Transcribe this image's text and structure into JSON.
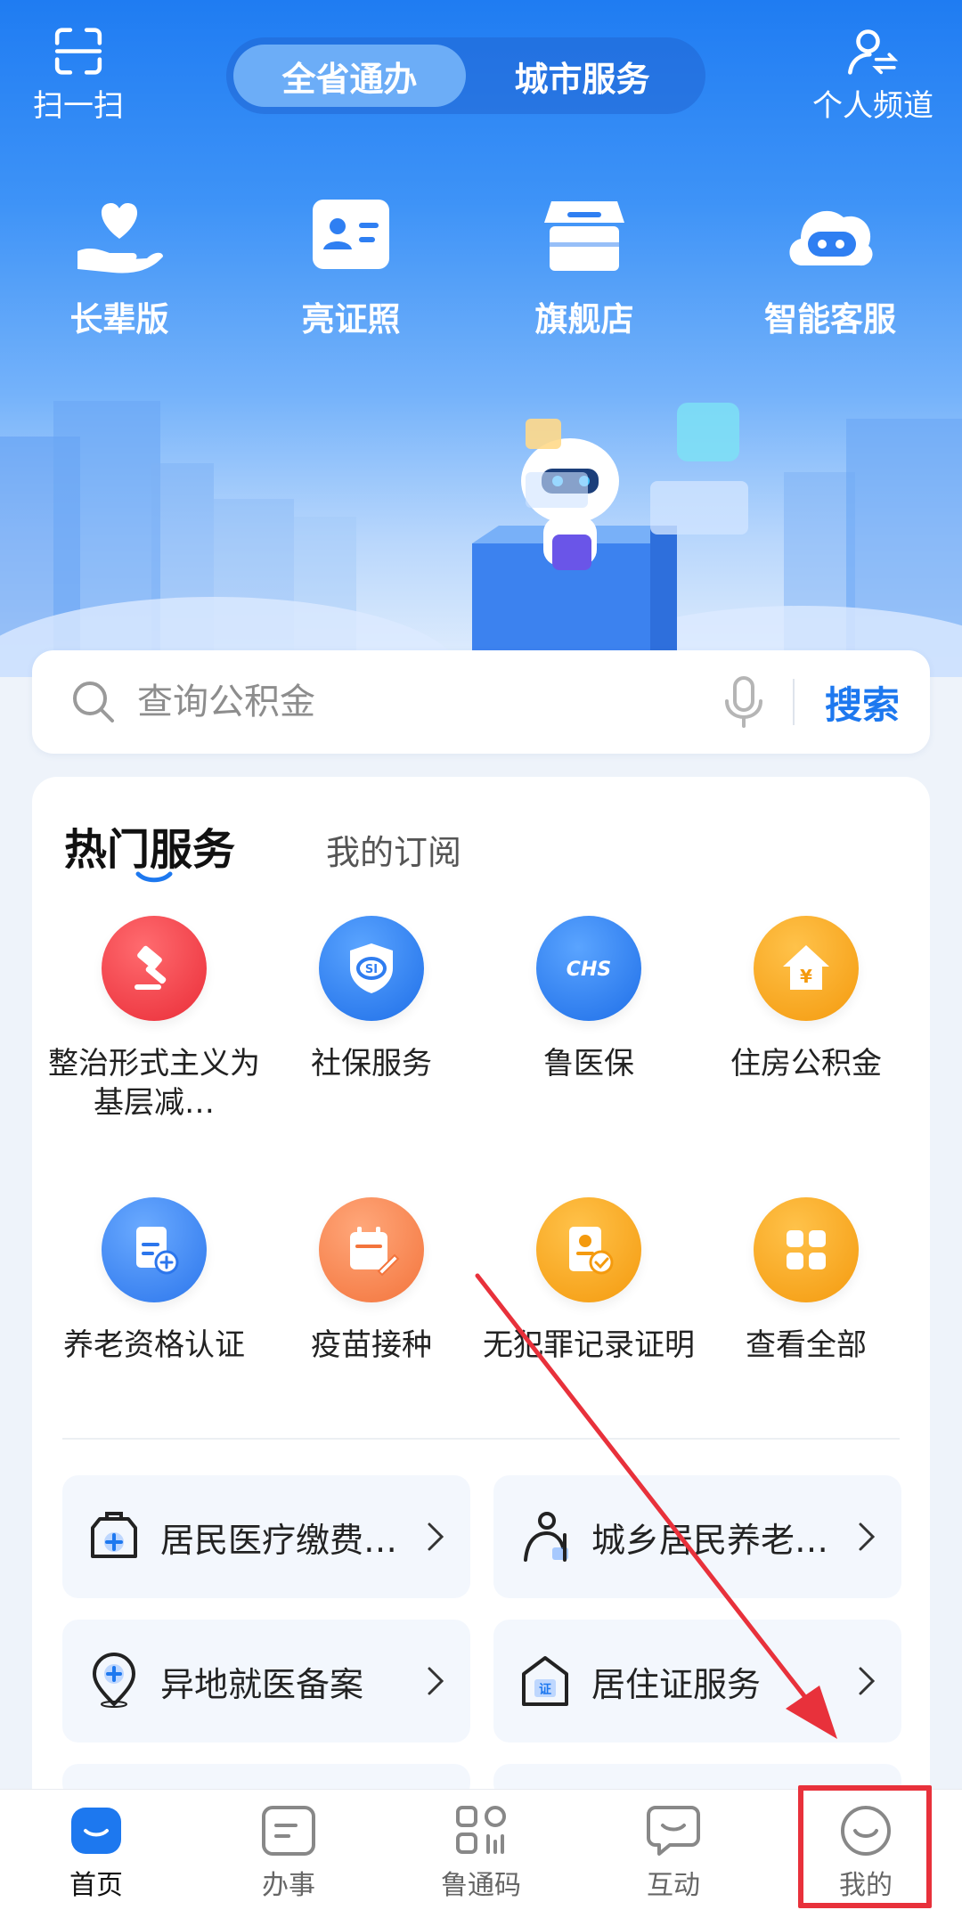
{
  "header": {
    "scan_label": "扫一扫",
    "personal_label": "个人频道",
    "segments": [
      {
        "label": "全省通办",
        "active": true
      },
      {
        "label": "城市服务",
        "active": false
      }
    ]
  },
  "quick_actions": [
    {
      "label": "长辈版",
      "icon": "heart-hand-icon"
    },
    {
      "label": "亮证照",
      "icon": "id-card-icon"
    },
    {
      "label": "旗舰店",
      "icon": "store-icon"
    },
    {
      "label": "智能客服",
      "icon": "robot-cloud-icon"
    }
  ],
  "search": {
    "placeholder": "查询公积金",
    "button_label": "搜索"
  },
  "services": {
    "tab_hot": "热门服务",
    "tab_subscribed": "我的订阅",
    "items": [
      {
        "label": "整治形式主义为基层减…",
        "icon": "gavel-icon",
        "color": "#f2414a"
      },
      {
        "label": "社保服务",
        "icon": "social-security-shield-icon",
        "color": "#2f7df0"
      },
      {
        "label": "鲁医保",
        "icon": "chs-icon",
        "color": "#2f7df0"
      },
      {
        "label": "住房公积金",
        "icon": "house-yuan-icon",
        "color": "#f7a21b"
      },
      {
        "label": "养老资格认证",
        "icon": "document-plus-icon",
        "color": "#3a86f2"
      },
      {
        "label": "疫苗接种",
        "icon": "calendar-vaccine-icon",
        "color": "#f88a52"
      },
      {
        "label": "无犯罪记录证明",
        "icon": "certificate-check-icon",
        "color": "#f7a21b"
      },
      {
        "label": "查看全部",
        "icon": "grid-icon",
        "color": "#f7a21b"
      }
    ]
  },
  "quick_links": [
    {
      "label": "居民医疗缴费…",
      "icon": "medical-bag-icon"
    },
    {
      "label": "城乡居民养老…",
      "icon": "elderly-person-icon"
    },
    {
      "label": "异地就医备案",
      "icon": "location-plus-icon"
    },
    {
      "label": "居住证服务",
      "icon": "residence-permit-icon"
    }
  ],
  "bottom_nav": [
    {
      "label": "首页",
      "icon": "home-icon",
      "active": true
    },
    {
      "label": "办事",
      "icon": "services-icon",
      "active": false
    },
    {
      "label": "鲁通码",
      "icon": "qr-code-icon",
      "active": false
    },
    {
      "label": "互动",
      "icon": "chat-icon",
      "active": false
    },
    {
      "label": "我的",
      "icon": "smile-icon",
      "active": false
    }
  ],
  "colors": {
    "primary": "#1d78ef",
    "annotation": "#e8313b"
  }
}
